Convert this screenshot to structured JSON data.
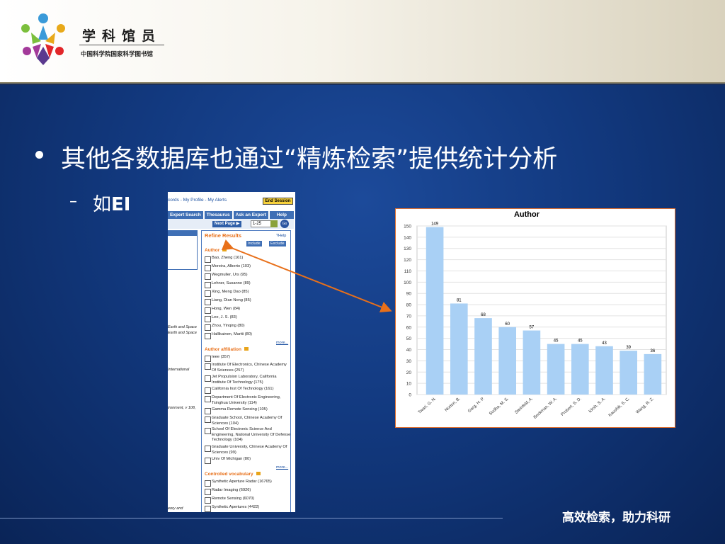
{
  "header": {
    "logo_title": "学科馆员",
    "logo_subtitle": "中国科学院国家科学图书馆"
  },
  "slide": {
    "bullet": "其他各数据库也通过“精炼检索”提供统计分析",
    "sub_dash": "–",
    "sub_prefix": "如",
    "sub_bold": "EI",
    "footer": "高效检索，助力科研"
  },
  "ei": {
    "top_links": "cords  -  My Profile  -  My Alerts",
    "end_session": "End Session",
    "tabs": [
      "Expert Search",
      "Thesaurus",
      "Ask an Expert",
      "Help"
    ],
    "next_page": "Next Page ▶",
    "page_range": "1-25",
    "go": "Go",
    "left_snippets": [
      "Earth and Space",
      "Earth and Space",
      "International",
      "ironment, v 108,",
      "eory and"
    ],
    "refine_title": "Refine Results",
    "help": "?Help",
    "include": "Include",
    "exclude": "Exclude",
    "sections": [
      {
        "title": "Author",
        "items": [
          "Bao, Zheng (161)",
          "Moreira, Alberto (103)",
          "Wegmuller, Urs (95)",
          "Lehner, Susanne (89)",
          "Xing, Meng Dao (85)",
          "Liang, Dian Nong (85)",
          "Hong, Wen (84)",
          "Lee, J. S. (83)",
          "Zhou, Yinqing (80)",
          "Hallikainen, Martti (80)"
        ],
        "more": "more..."
      },
      {
        "title": "Author affiliation",
        "items": [
          "Ieee (357)",
          "Institute Of Electronics, Chinese Academy Of Sciences (257)",
          "Jet Propulsion Laboratory, California Institute Of Technology (175)",
          "California Inst Of Technology (161)",
          "Department Of Electronic Engineering, Tsinghua University (114)",
          "Gamma Remote Sensing (105)",
          "Graduate School, Chinese Academy Of Sciences (104)",
          "School Of Electronic Science And Engineering, National University Of Defense Technology (104)",
          "Graduate University, Chinese Academy Of Sciences (99)",
          "Univ Of Michigan (80)"
        ],
        "more": "more..."
      },
      {
        "title": "Controlled vocabulary",
        "items": [
          "Synthetic Aperture Radar (16765)",
          "Radar Imaging (6926)",
          "Remote Sensing (6070)",
          "Synthetic Apertures (4422)"
        ],
        "more": ""
      }
    ]
  },
  "chart_data": {
    "type": "bar",
    "title": "Author",
    "categories": [
      "Twari, G. N.",
      "Norton, B.",
      "Garg, H. P.",
      "Sodha, M. S.",
      "Steinfeld, A.",
      "Beckman, W. A.",
      "Probert, S. D.",
      "Kirsh, S. A.",
      "Kaushik, S. C.",
      "Wang, R. Z."
    ],
    "values": [
      149,
      81,
      68,
      60,
      57,
      45,
      45,
      43,
      39,
      36
    ],
    "ylim": [
      0,
      150
    ],
    "yticks": [
      0,
      10,
      20,
      30,
      40,
      50,
      60,
      70,
      80,
      90,
      100,
      110,
      120,
      130,
      140,
      150
    ],
    "bar_color": "#a9d0f5",
    "grid": true
  },
  "colors": {
    "slide_bg": "#12397f",
    "arrow": "#e8701a",
    "chart_border": "#e07030"
  }
}
